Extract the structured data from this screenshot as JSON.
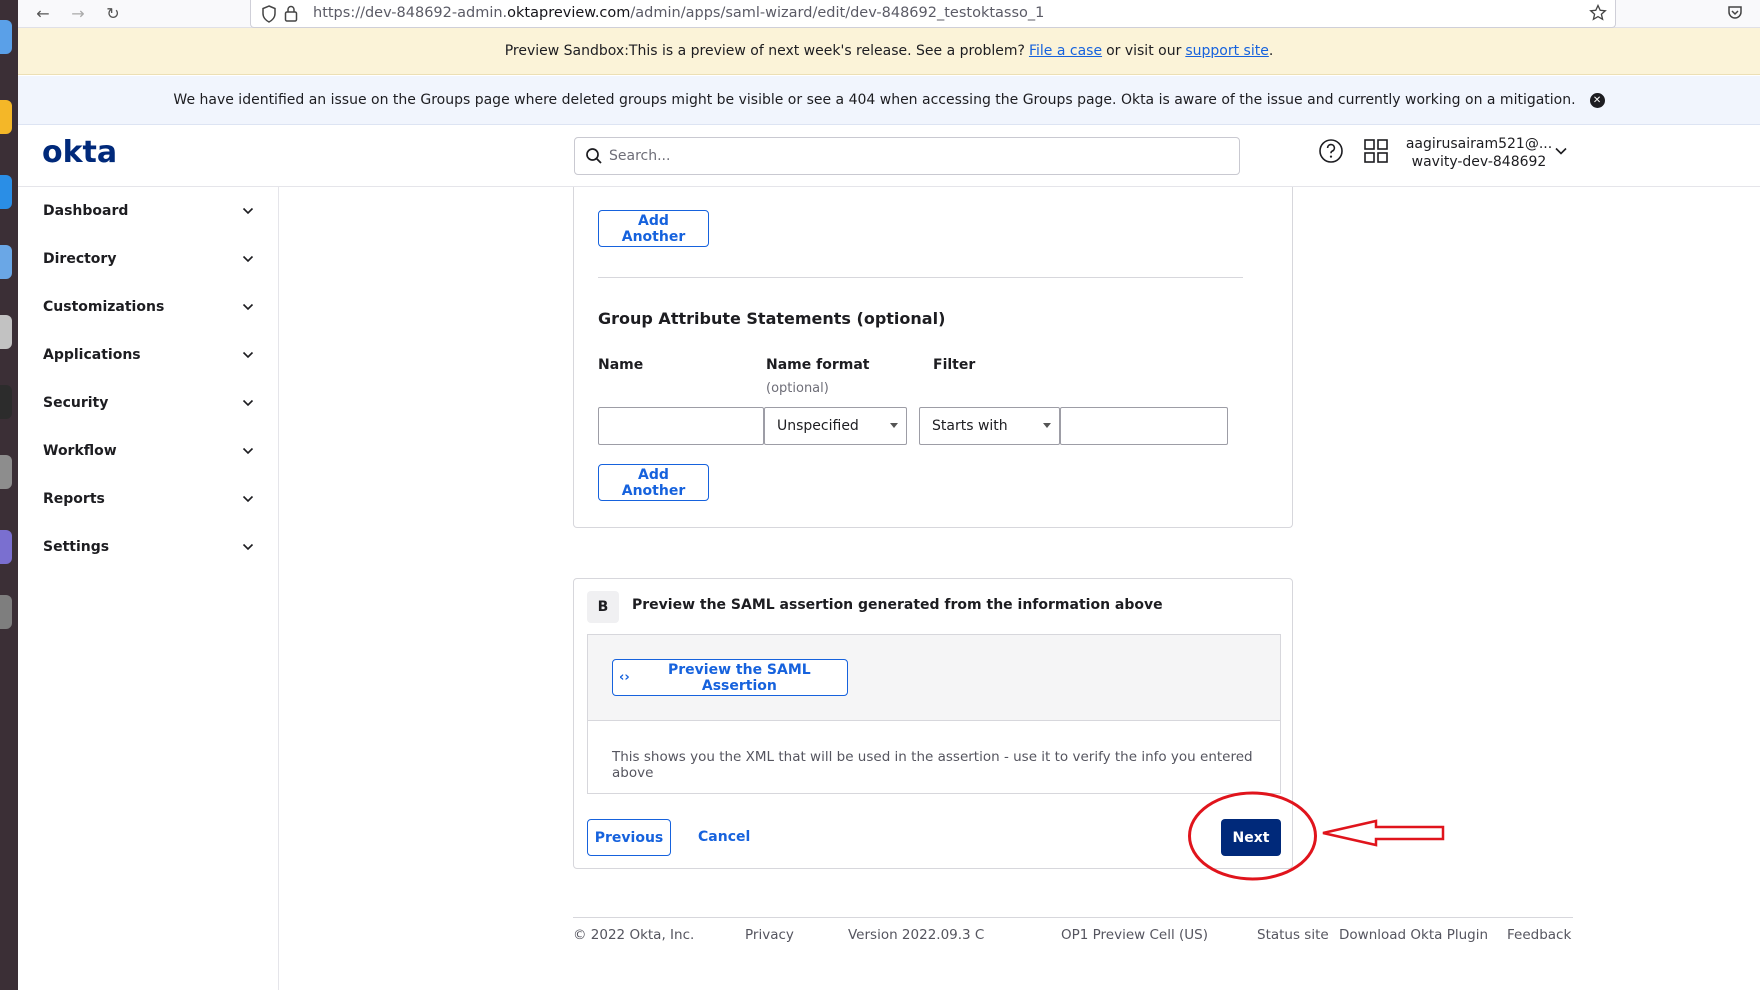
{
  "browser": {
    "url_prefix": "https://dev-848692-admin.",
    "url_domain": "oktapreview.com",
    "url_path": "/admin/apps/saml-wizard/edit/dev-848692_testoktasso_1"
  },
  "banners": {
    "sandbox_text": "Preview Sandbox:This is a preview of next week's release. See a problem?",
    "sandbox_link1": "File a case",
    "sandbox_mid": "or visit our",
    "sandbox_link2": "support site",
    "sandbox_end": ".",
    "issue_text": "We have identified an issue on the Groups page where deleted groups might be visible or see a 404 when accessing the Groups page. Okta is aware of the issue and currently working on a mitigation."
  },
  "header": {
    "logo": "okta",
    "search_placeholder": "Search...",
    "user_email": "aagirusairam521@...",
    "user_org": "wavity-dev-848692"
  },
  "sidebar": {
    "items": [
      {
        "label": "Dashboard"
      },
      {
        "label": "Directory"
      },
      {
        "label": "Customizations"
      },
      {
        "label": "Applications"
      },
      {
        "label": "Security"
      },
      {
        "label": "Workflow"
      },
      {
        "label": "Reports"
      },
      {
        "label": "Settings"
      }
    ]
  },
  "attributes": {
    "add_another_label": "Add Another",
    "group_title": "Group Attribute Statements (optional)",
    "col_name": "Name",
    "col_name_format": "Name format",
    "col_name_format_sub": "(optional)",
    "col_filter": "Filter",
    "name_value": "",
    "name_format_value": "Unspecified",
    "filter_type_value": "Starts with",
    "filter_value": ""
  },
  "section_b": {
    "badge": "B",
    "title": "Preview the SAML assertion generated from the information above",
    "preview_button": "Preview the SAML Assertion",
    "preview_icon_glyph": "‹›",
    "description": "This shows you the XML that will be used in the assertion - use it to verify the info you entered above",
    "previous_label": "Previous",
    "cancel_label": "Cancel",
    "next_label": "Next"
  },
  "footer": {
    "copyright": "© 2022 Okta, Inc.",
    "privacy": "Privacy",
    "version": "Version 2022.09.3 C",
    "cell": "OP1 Preview Cell (US)",
    "status": "Status site",
    "plugin": "Download Okta Plugin",
    "feedback": "Feedback"
  },
  "colors": {
    "primary": "#1662dd",
    "brand_navy": "#00297a",
    "annotation_red": "#e0141c"
  }
}
